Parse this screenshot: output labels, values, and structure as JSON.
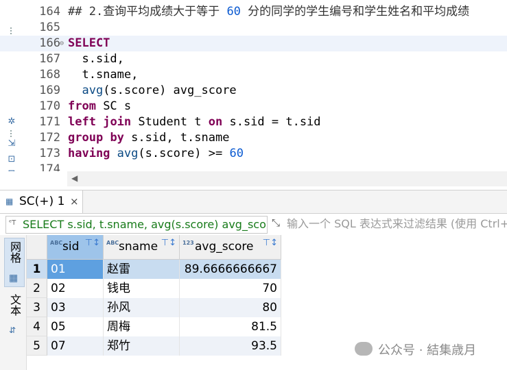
{
  "editor": {
    "lines": [
      {
        "n": "164",
        "parts": [
          {
            "t": "## 2.",
            "c": "cm"
          },
          {
            "t": "查询平均成绩大于等于 ",
            "c": "cm"
          },
          {
            "t": "60",
            "c": "cmn"
          },
          {
            "t": " 分的同学的学生编号和学生姓名和平均成绩",
            "c": "cm"
          }
        ]
      },
      {
        "n": "165",
        "parts": []
      },
      {
        "n": "166",
        "fold": "⊖",
        "cur": true,
        "parts": [
          {
            "t": "SELECT",
            "c": "kw"
          }
        ]
      },
      {
        "n": "167",
        "parts": [
          {
            "t": "  s.sid,",
            "c": ""
          }
        ]
      },
      {
        "n": "168",
        "parts": [
          {
            "t": "  t.sname,",
            "c": ""
          }
        ]
      },
      {
        "n": "169",
        "parts": [
          {
            "t": "  ",
            "c": ""
          },
          {
            "t": "avg",
            "c": "fn"
          },
          {
            "t": "(s.score) avg_score",
            "c": ""
          }
        ]
      },
      {
        "n": "170",
        "parts": [
          {
            "t": "from",
            "c": "kw"
          },
          {
            "t": " SC s",
            "c": ""
          }
        ]
      },
      {
        "n": "171",
        "parts": [
          {
            "t": "left",
            "c": "kw"
          },
          {
            "t": " ",
            "c": ""
          },
          {
            "t": "join",
            "c": "kw"
          },
          {
            "t": " Student t ",
            "c": ""
          },
          {
            "t": "on",
            "c": "kw"
          },
          {
            "t": " s.sid = t.sid",
            "c": ""
          }
        ]
      },
      {
        "n": "172",
        "parts": [
          {
            "t": "group",
            "c": "kw"
          },
          {
            "t": " ",
            "c": ""
          },
          {
            "t": "by",
            "c": "kw"
          },
          {
            "t": " s.sid, t.sname",
            "c": ""
          }
        ]
      },
      {
        "n": "173",
        "parts": [
          {
            "t": "having",
            "c": "kw"
          },
          {
            "t": " ",
            "c": ""
          },
          {
            "t": "avg",
            "c": "fn"
          },
          {
            "t": "(s.score) >= ",
            "c": ""
          },
          {
            "t": "60",
            "c": "num"
          }
        ]
      },
      {
        "n": "174",
        "parts": []
      }
    ]
  },
  "results": {
    "tab_label": "SC(+) 1",
    "tab_close": "×",
    "query_text": "SELECT s.sid, t.sname, avg(s.score) avg_score FROM SC s LEFT JOIN Student t ON s.sid = t.sid",
    "filter_placeholder": "输入一个 SQL 表达式来过滤结果 (使用 Ctrl+Space)",
    "side_tabs": {
      "grid": "网格",
      "text": "文本"
    },
    "columns": [
      {
        "name": "sid",
        "type": "ABC"
      },
      {
        "name": "sname",
        "type": "ABC"
      },
      {
        "name": "avg_score",
        "type": "123"
      }
    ],
    "rows": [
      {
        "idx": "1",
        "sid": "01",
        "sname": "赵雷",
        "avg_score": "89.6666666667"
      },
      {
        "idx": "2",
        "sid": "02",
        "sname": "钱电",
        "avg_score": "70"
      },
      {
        "idx": "3",
        "sid": "03",
        "sname": "孙风",
        "avg_score": "80"
      },
      {
        "idx": "4",
        "sid": "05",
        "sname": "周梅",
        "avg_score": "81.5"
      },
      {
        "idx": "5",
        "sid": "07",
        "sname": "郑竹",
        "avg_score": "93.5"
      }
    ]
  },
  "watermark": "公众号 · 結集歳月",
  "colors": {
    "keyword": "#7f0055",
    "number": "#0b5ad1",
    "query_text": "#187b1a",
    "selection": "#5ea0e0"
  }
}
